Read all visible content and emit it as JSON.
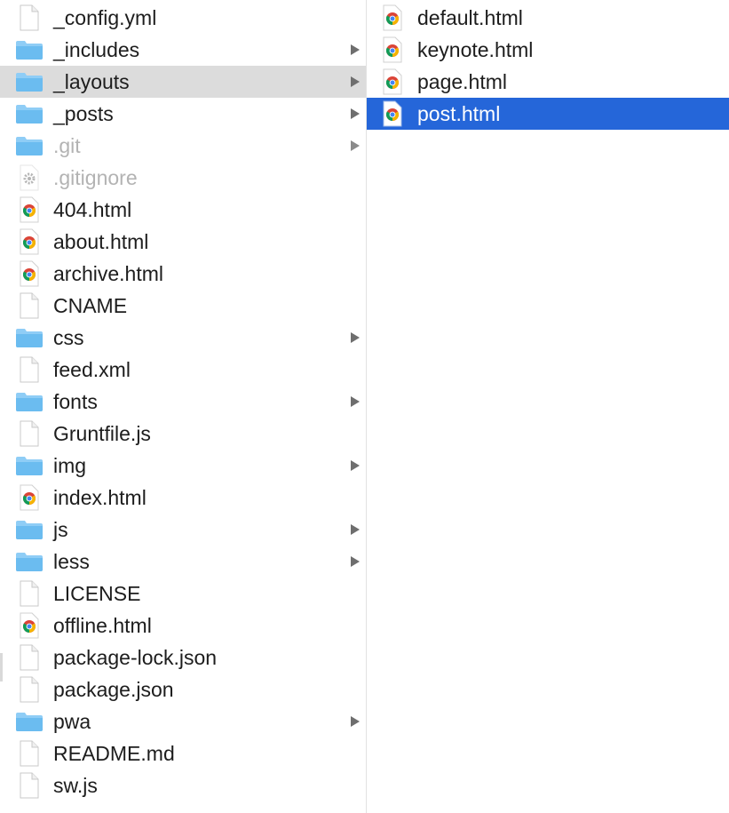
{
  "colors": {
    "selection": "#2566d9",
    "parent_highlight": "#dcdcdc",
    "folder": "#6bbcf0",
    "dim_text": "#b3b3b3"
  },
  "left_column": {
    "items": [
      {
        "name": "_config.yml",
        "kind": "file",
        "icon": "document-icon",
        "has_children": false,
        "dim": false,
        "highlight": false
      },
      {
        "name": "_includes",
        "kind": "folder",
        "icon": "folder-icon",
        "has_children": true,
        "dim": false,
        "highlight": false
      },
      {
        "name": "_layouts",
        "kind": "folder",
        "icon": "folder-icon",
        "has_children": true,
        "dim": false,
        "highlight": true
      },
      {
        "name": "_posts",
        "kind": "folder",
        "icon": "folder-icon",
        "has_children": true,
        "dim": false,
        "highlight": false
      },
      {
        "name": ".git",
        "kind": "folder",
        "icon": "folder-icon",
        "has_children": true,
        "dim": true,
        "highlight": false
      },
      {
        "name": ".gitignore",
        "kind": "gear",
        "icon": "gear-icon",
        "has_children": false,
        "dim": true,
        "highlight": false
      },
      {
        "name": "404.html",
        "kind": "html",
        "icon": "chrome-icon",
        "has_children": false,
        "dim": false,
        "highlight": false
      },
      {
        "name": "about.html",
        "kind": "html",
        "icon": "chrome-icon",
        "has_children": false,
        "dim": false,
        "highlight": false
      },
      {
        "name": "archive.html",
        "kind": "html",
        "icon": "chrome-icon",
        "has_children": false,
        "dim": false,
        "highlight": false
      },
      {
        "name": "CNAME",
        "kind": "file",
        "icon": "document-icon",
        "has_children": false,
        "dim": false,
        "highlight": false
      },
      {
        "name": "css",
        "kind": "folder",
        "icon": "folder-icon",
        "has_children": true,
        "dim": false,
        "highlight": false
      },
      {
        "name": "feed.xml",
        "kind": "file",
        "icon": "document-icon",
        "has_children": false,
        "dim": false,
        "highlight": false
      },
      {
        "name": "fonts",
        "kind": "folder",
        "icon": "folder-icon",
        "has_children": true,
        "dim": false,
        "highlight": false
      },
      {
        "name": "Gruntfile.js",
        "kind": "file",
        "icon": "document-icon",
        "has_children": false,
        "dim": false,
        "highlight": false
      },
      {
        "name": "img",
        "kind": "folder",
        "icon": "folder-icon",
        "has_children": true,
        "dim": false,
        "highlight": false
      },
      {
        "name": "index.html",
        "kind": "html",
        "icon": "chrome-icon",
        "has_children": false,
        "dim": false,
        "highlight": false
      },
      {
        "name": "js",
        "kind": "folder",
        "icon": "folder-icon",
        "has_children": true,
        "dim": false,
        "highlight": false
      },
      {
        "name": "less",
        "kind": "folder",
        "icon": "folder-icon",
        "has_children": true,
        "dim": false,
        "highlight": false
      },
      {
        "name": "LICENSE",
        "kind": "file",
        "icon": "document-icon",
        "has_children": false,
        "dim": false,
        "highlight": false
      },
      {
        "name": "offline.html",
        "kind": "html",
        "icon": "chrome-icon",
        "has_children": false,
        "dim": false,
        "highlight": false
      },
      {
        "name": "package-lock.json",
        "kind": "file",
        "icon": "document-icon",
        "has_children": false,
        "dim": false,
        "highlight": false
      },
      {
        "name": "package.json",
        "kind": "file",
        "icon": "document-icon",
        "has_children": false,
        "dim": false,
        "highlight": false
      },
      {
        "name": "pwa",
        "kind": "folder",
        "icon": "folder-icon",
        "has_children": true,
        "dim": false,
        "highlight": false
      },
      {
        "name": "README.md",
        "kind": "file",
        "icon": "document-icon",
        "has_children": false,
        "dim": false,
        "highlight": false
      },
      {
        "name": "sw.js",
        "kind": "file",
        "icon": "document-icon",
        "has_children": false,
        "dim": false,
        "highlight": false
      }
    ]
  },
  "right_column": {
    "items": [
      {
        "name": "default.html",
        "kind": "html",
        "icon": "chrome-icon",
        "selected": false
      },
      {
        "name": "keynote.html",
        "kind": "html",
        "icon": "chrome-icon",
        "selected": false
      },
      {
        "name": "page.html",
        "kind": "html",
        "icon": "chrome-icon",
        "selected": false
      },
      {
        "name": "post.html",
        "kind": "html",
        "icon": "chrome-icon",
        "selected": true
      }
    ]
  }
}
